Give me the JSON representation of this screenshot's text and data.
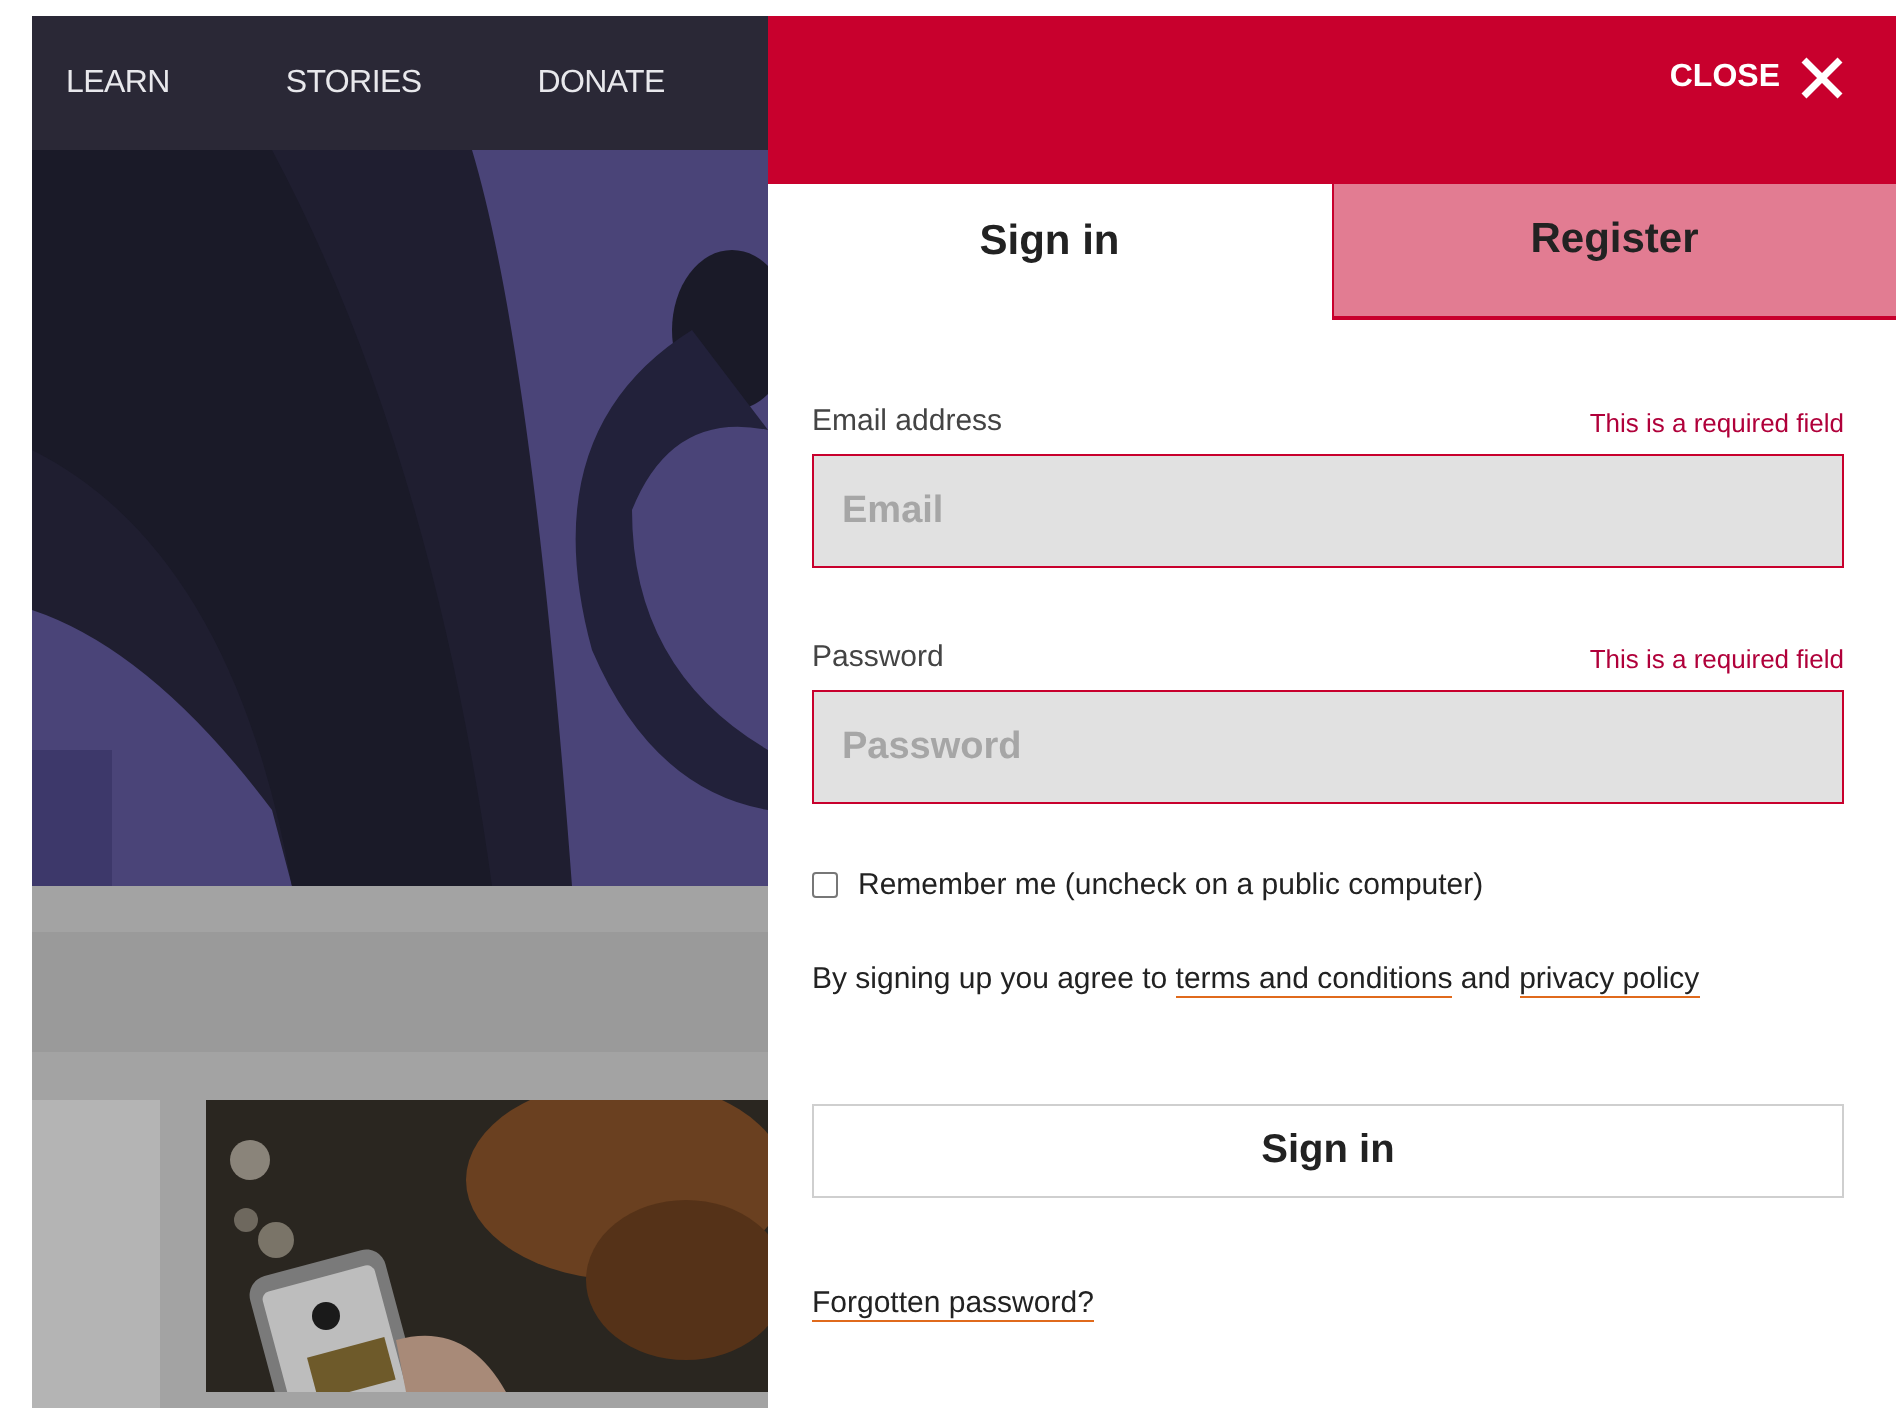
{
  "nav": [
    {
      "label": "LEARN"
    },
    {
      "label": "STORIES"
    },
    {
      "label": "DONATE"
    }
  ],
  "panel": {
    "close_label": "CLOSE",
    "tabs": [
      {
        "label": "Sign in",
        "selected": true
      },
      {
        "label": "Register",
        "selected": false
      }
    ],
    "fields": [
      {
        "label": "Email address",
        "error": "This is a required field",
        "placeholder": "Email"
      },
      {
        "label": "Password",
        "error": "This is a required field",
        "placeholder": "Password"
      }
    ],
    "remember": {
      "label": "Remember me (uncheck on a public computer)",
      "checked": false
    },
    "agreement": {
      "before": "By signing up you agree to",
      "terms_link": "terms and conditions",
      "middle": "and",
      "privacy_link": "privacy policy"
    },
    "submit": "Sign in",
    "forgot_link": "Forgotten password?"
  }
}
